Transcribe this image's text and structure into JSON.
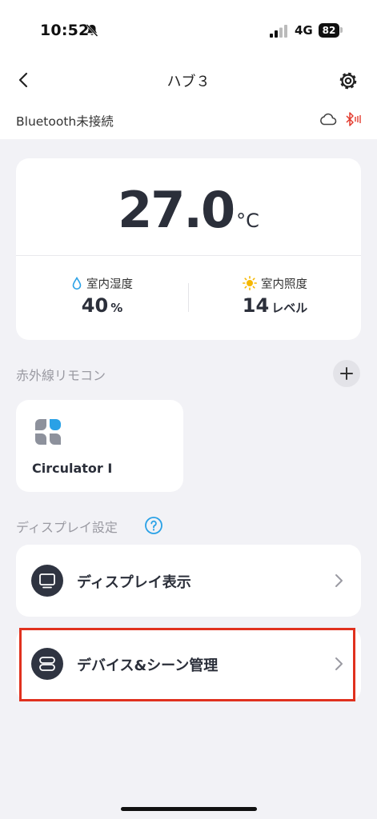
{
  "status_bar": {
    "time": "10:52",
    "network": "4G",
    "battery": "82"
  },
  "nav": {
    "title": "ハブ３"
  },
  "connection": {
    "bluetooth_status": "Bluetooth未接続"
  },
  "sensors": {
    "temperature": {
      "value": "27.0",
      "unit": "°C"
    },
    "humidity": {
      "label": "室内湿度",
      "value": "40",
      "unit": "%"
    },
    "illuminance": {
      "label": "室内照度",
      "value": "14",
      "unit": "レベル"
    }
  },
  "ir_remote": {
    "title": "赤外線リモコン",
    "devices": [
      {
        "name": "Circulator I"
      }
    ]
  },
  "display_settings": {
    "title": "ディスプレイ設定",
    "rows": [
      {
        "label": "ディスプレイ表示"
      },
      {
        "label": "デバイス&シーン管理"
      }
    ]
  },
  "colors": {
    "accent_blue": "#2aa1e6",
    "highlight_red": "#e0311e",
    "bluetooth_red": "#e33b2e",
    "sun_yellow": "#f5b700"
  },
  "icons": [
    "bell-off-icon",
    "signal-icon",
    "back-arrow-icon",
    "gear-icon",
    "cloud-icon",
    "bluetooth-off-icon",
    "droplet-icon",
    "sun-icon",
    "plus-icon",
    "fan-icon",
    "help-icon",
    "monitor-icon",
    "toggle-icon",
    "chevron-right-icon"
  ]
}
